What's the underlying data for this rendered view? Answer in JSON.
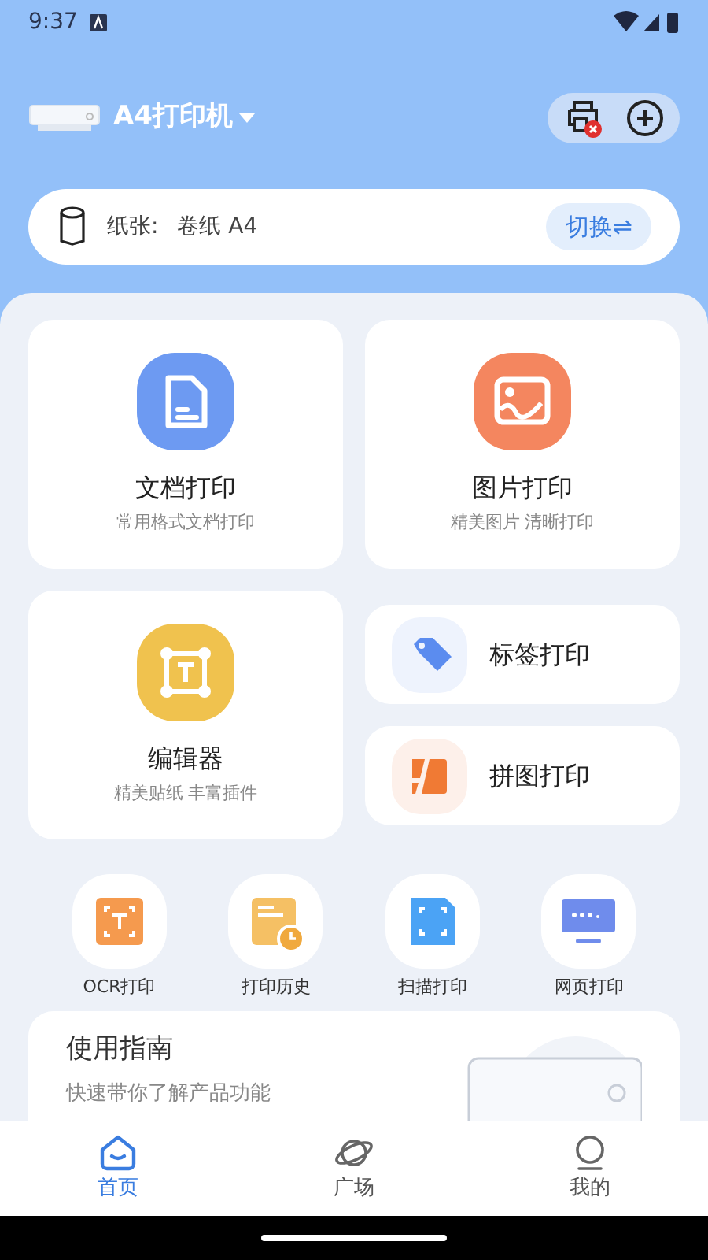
{
  "status_bar": {
    "time": "9:37"
  },
  "header": {
    "printer_name": "A4打印机"
  },
  "paper": {
    "label": "纸张:",
    "value": "卷纸 A4",
    "switch_button": "切换⇌"
  },
  "big_cards": [
    {
      "kind": "doc",
      "title": "文档打印",
      "subtitle": "常用格式文档打印"
    },
    {
      "kind": "photo",
      "title": "图片打印",
      "subtitle": "精美图片 清晰打印"
    }
  ],
  "editor_card": {
    "title": "编辑器",
    "subtitle": "精美贴纸 丰富插件"
  },
  "small_cards": [
    {
      "kind": "tag",
      "title": "标签打印"
    },
    {
      "kind": "collage",
      "title": "拼图打印"
    }
  ],
  "quick_actions": [
    {
      "kind": "ocr",
      "label": "OCR打印"
    },
    {
      "kind": "history",
      "label": "打印历史"
    },
    {
      "kind": "scan",
      "label": "扫描打印"
    },
    {
      "kind": "web",
      "label": "网页打印"
    }
  ],
  "guide": {
    "title": "使用指南",
    "subtitle": "快速带你了解产品功能"
  },
  "tab_bar": [
    {
      "kind": "home",
      "label": "首页",
      "selected": true
    },
    {
      "kind": "planet",
      "label": "广场",
      "selected": false
    },
    {
      "kind": "profile",
      "label": "我的",
      "selected": false
    }
  ]
}
